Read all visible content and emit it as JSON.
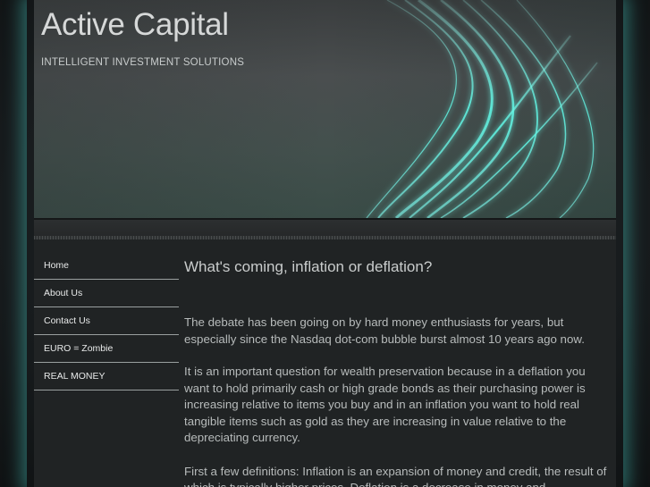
{
  "header": {
    "title": "Active Capital",
    "tagline": "INTELLIGENT INVESTMENT SOLUTIONS"
  },
  "nav": {
    "items": [
      {
        "label": "Home"
      },
      {
        "label": "About Us"
      },
      {
        "label": "Contact Us"
      },
      {
        "label": "EURO = Zombie"
      },
      {
        "label": "REAL MONEY"
      }
    ]
  },
  "main": {
    "title": "What's coming, inflation or deflation?",
    "paragraphs": [
      "The debate has been going on by hard money enthusiasts for years, but especially since the Nasdaq dot-com bubble burst almost 10 years ago now.",
      "It is an important question for wealth preservation because in a deflation you want to hold primarily cash or high grade bonds as their purchasing power is increasing relative to items you buy and in an inflation you want to hold real tangible items such as gold as they are increasing in value relative to the depreciating currency.",
      "First a few definitions: Inflation is an expansion of money and credit, the result of which is typically higher prices. Deflation is a decrease in money and"
    ]
  },
  "colors": {
    "accent_glow": "#46c8be",
    "background": "#16191b",
    "panel": "#202324",
    "header_swirl": "#5ef0df"
  }
}
